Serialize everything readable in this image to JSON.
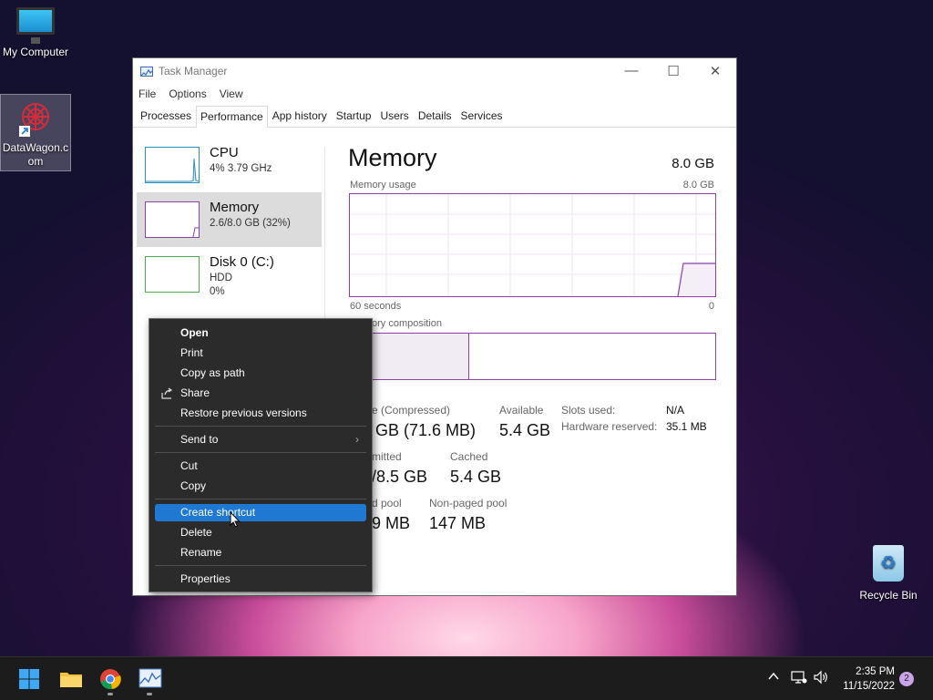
{
  "desktop": {
    "icons": [
      {
        "label": "My Computer"
      },
      {
        "label": "DataWagon.c om"
      },
      {
        "label": "Recycle Bin"
      }
    ]
  },
  "taskmgr": {
    "title": "Task Manager",
    "menu": [
      "File",
      "Options",
      "View"
    ],
    "tabs": [
      "Processes",
      "Performance",
      "App history",
      "Startup",
      "Users",
      "Details",
      "Services"
    ],
    "active_tab": "Performance",
    "resources": [
      {
        "name": "CPU",
        "sub1": "4% 3.79 GHz",
        "sub2": ""
      },
      {
        "name": "Memory",
        "sub1": "2.6/8.0 GB (32%)",
        "sub2": ""
      },
      {
        "name": "Disk 0 (C:)",
        "sub1": "HDD",
        "sub2": "0%"
      }
    ],
    "memory": {
      "title": "Memory",
      "total": "8.0 GB",
      "usage_label": "Memory usage",
      "usage_max": "8.0 GB",
      "time_left": "60 seconds",
      "time_right": "0",
      "composition_label": "ory composition",
      "stats": {
        "in_use_label": "e (Compressed)",
        "in_use_value": "GB (71.6 MB)",
        "available_label": "Available",
        "available_value": "5.4 GB",
        "committed_label": "mitted",
        "committed_value": "/8.5 GB",
        "cached_label": "Cached",
        "cached_value": "5.4 GB",
        "paged_label": "d pool",
        "paged_value": "9 MB",
        "nonpaged_label": "Non-paged pool",
        "nonpaged_value": "147 MB",
        "slots_label": "Slots used:",
        "slots_value": "N/A",
        "hwres_label": "Hardware reserved:",
        "hwres_value": "35.1 MB"
      }
    }
  },
  "context_menu": {
    "items": [
      {
        "label": "Open",
        "bold": true
      },
      {
        "label": "Print"
      },
      {
        "label": "Copy as path"
      },
      {
        "label": "Share",
        "icon": "share-icon"
      },
      {
        "label": "Restore previous versions"
      },
      {
        "label": "Send to",
        "submenu": true
      },
      {
        "label": "Cut"
      },
      {
        "label": "Copy"
      },
      {
        "label": "Create shortcut",
        "highlighted": true
      },
      {
        "label": "Delete"
      },
      {
        "label": "Rename"
      },
      {
        "label": "Properties"
      }
    ]
  },
  "taskbar": {
    "apps": [
      "start-icon",
      "file-explorer-icon",
      "chrome-icon",
      "task-manager-icon"
    ],
    "time": "2:35 PM",
    "date": "11/15/2022",
    "notifications": "2"
  },
  "colors": {
    "accent": "#1f78d1",
    "memory_graph": "#8b3fa8",
    "cpu_graph": "#2a8fbf",
    "disk_graph": "#4ca84c"
  }
}
